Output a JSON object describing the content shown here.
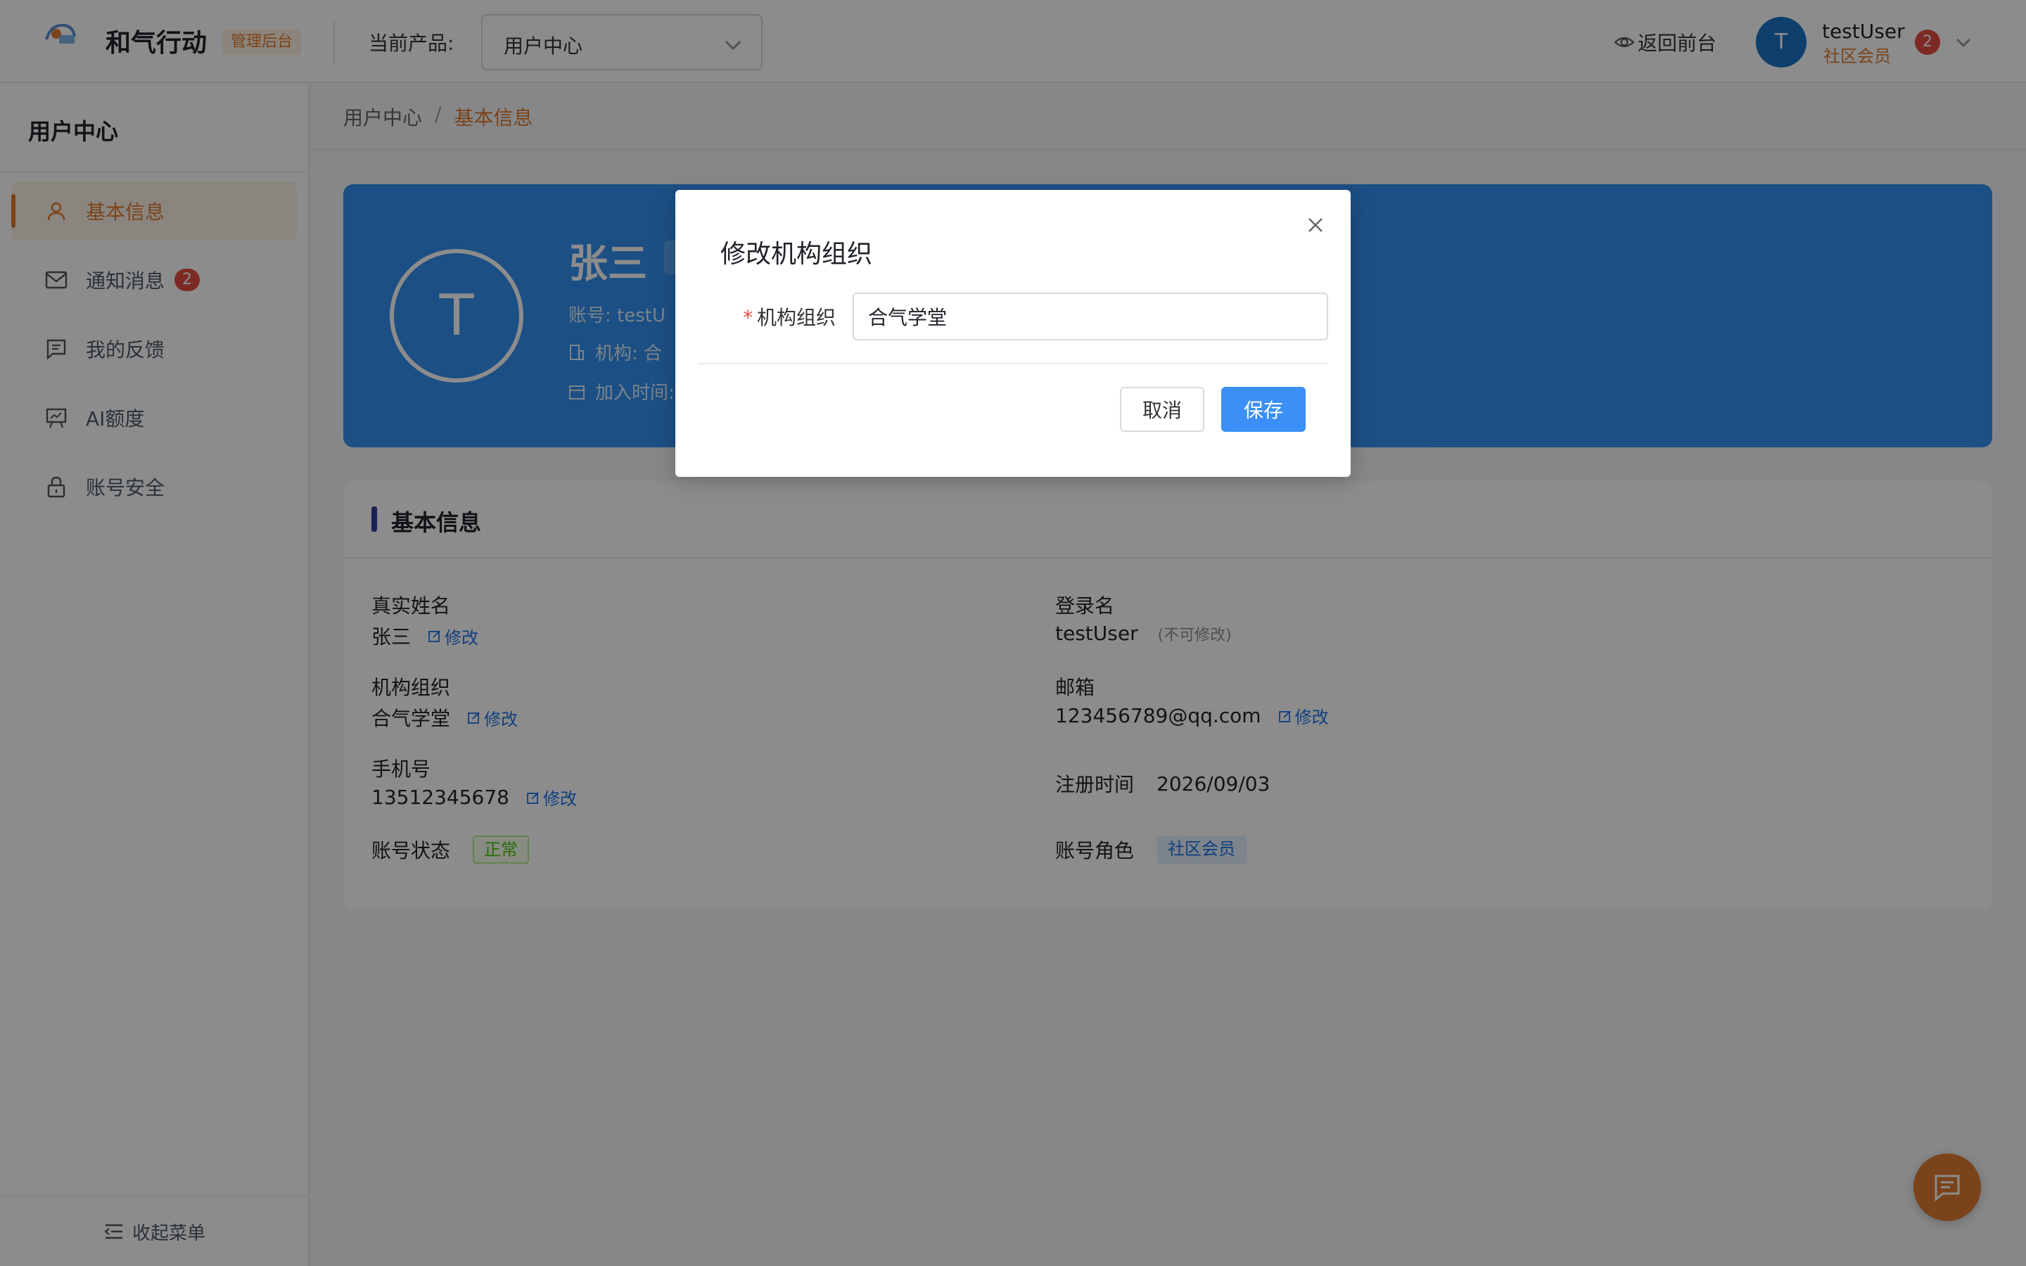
{
  "header": {
    "app_title": "和气行动",
    "admin_badge": "管理后台",
    "product_label": "当前产品:",
    "product_value": "用户中心",
    "back_link": "返回前台",
    "user": {
      "avatar_initial": "T",
      "name": "testUser",
      "role": "社区会员",
      "notification_count": "2"
    }
  },
  "sidebar": {
    "title": "用户中心",
    "items": [
      {
        "label": "基本信息",
        "icon": "user-icon",
        "active": true
      },
      {
        "label": "通知消息",
        "icon": "mail-icon",
        "badge": "2"
      },
      {
        "label": "我的反馈",
        "icon": "feedback-icon"
      },
      {
        "label": "AI额度",
        "icon": "presentation-icon"
      },
      {
        "label": "账号安全",
        "icon": "lock-icon"
      }
    ],
    "collapse_label": "收起菜单"
  },
  "breadcrumb": {
    "root": "用户中心",
    "sep": "/",
    "current": "基本信息"
  },
  "banner": {
    "avatar_initial": "T",
    "name": "张三",
    "account_partial": "账号: testU",
    "org_partial": "机构: 合",
    "join_partial": "加入时间:"
  },
  "info": {
    "title": "基本信息",
    "edit_label": "修改",
    "real_name_label": "真实姓名",
    "real_name": "张三",
    "org_label": "机构组织",
    "org": "合气学堂",
    "phone_label": "手机号",
    "phone": "13512345678",
    "status_label": "账号状态",
    "status": "正常",
    "login_label": "登录名",
    "login": "testUser",
    "login_note": "(不可修改)",
    "email_label": "邮箱",
    "email": "123456789@qq.com",
    "reg_label": "注册时间",
    "reg_date": "2026/09/03",
    "role_label": "账号角色",
    "role": "社区会员"
  },
  "modal": {
    "title": "修改机构组织",
    "field_label": "机构组织",
    "required_mark": "*",
    "field_value": "合气学堂",
    "cancel": "取消",
    "save": "保存"
  },
  "colors": {
    "accent": "#e07a2e",
    "primary": "#3b8ff6",
    "banner": "#3491f0"
  }
}
